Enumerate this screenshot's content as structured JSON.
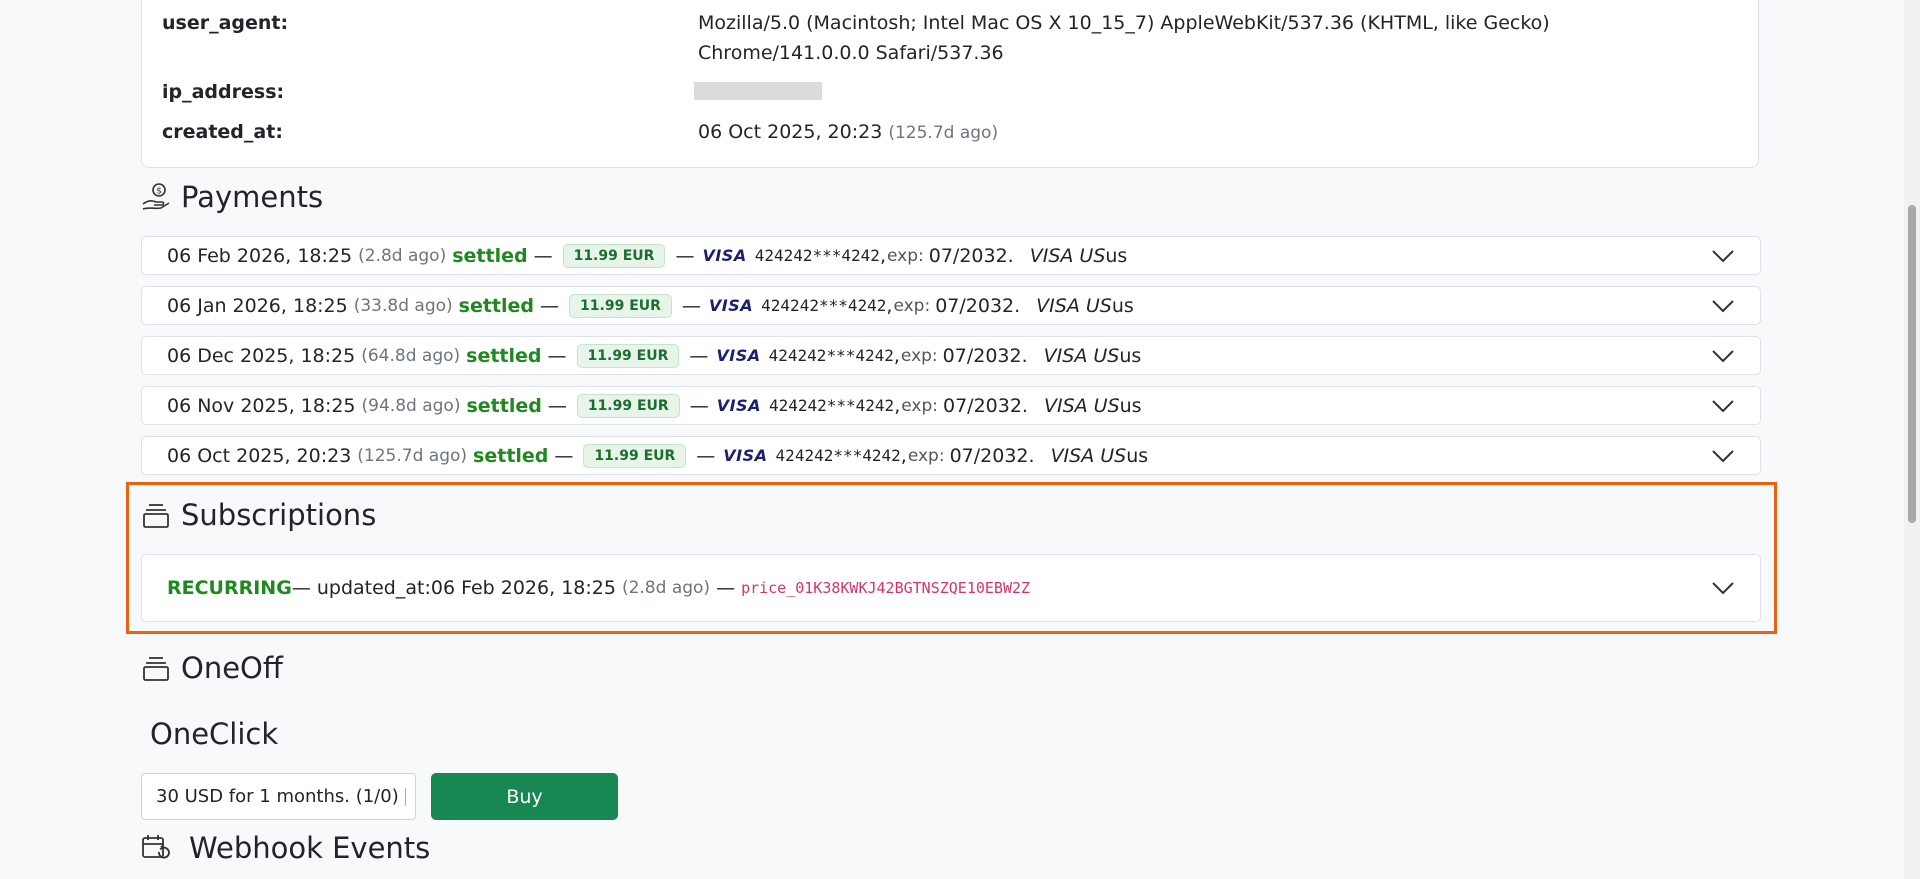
{
  "session": {
    "user_agent_key": "user_agent:",
    "user_agent_val": "Mozilla/5.0 (Macintosh; Intel Mac OS X 10_15_7) AppleWebKit/537.36 (KHTML, like Gecko) Chrome/141.0.0.0 Safari/537.36",
    "ip_key": "ip_address:",
    "created_key": "created_at:",
    "created_val": "06 Oct 2025, 20:23",
    "created_ago": "(125.7d ago)"
  },
  "payments": {
    "title": "Payments",
    "items": [
      {
        "date": "06 Feb 2026, 18:25",
        "ago": "(2.8d ago)",
        "status": "settled",
        "amount": "11.99 EUR",
        "brand": "VISA",
        "card": "424242***4242",
        "exp_label": "exp:",
        "exp": "07/2032.",
        "brand_text": "VISA US",
        "country": "us"
      },
      {
        "date": "06 Jan 2026, 18:25",
        "ago": "(33.8d ago)",
        "status": "settled",
        "amount": "11.99 EUR",
        "brand": "VISA",
        "card": "424242***4242",
        "exp_label": "exp:",
        "exp": "07/2032.",
        "brand_text": "VISA US",
        "country": "us"
      },
      {
        "date": "06 Dec 2025, 18:25",
        "ago": "(64.8d ago)",
        "status": "settled",
        "amount": "11.99 EUR",
        "brand": "VISA",
        "card": "424242***4242",
        "exp_label": "exp:",
        "exp": "07/2032.",
        "brand_text": "VISA US",
        "country": "us"
      },
      {
        "date": "06 Nov 2025, 18:25",
        "ago": "(94.8d ago)",
        "status": "settled",
        "amount": "11.99 EUR",
        "brand": "VISA",
        "card": "424242***4242",
        "exp_label": "exp:",
        "exp": "07/2032.",
        "brand_text": "VISA US",
        "country": "us"
      },
      {
        "date": "06 Oct 2025, 20:23",
        "ago": "(125.7d ago)",
        "status": "settled",
        "amount": "11.99 EUR",
        "brand": "VISA",
        "card": "424242***4242",
        "exp_label": "exp:",
        "exp": "07/2032.",
        "brand_text": "VISA US",
        "country": "us"
      }
    ]
  },
  "subscriptions": {
    "title": "Subscriptions",
    "item": {
      "type": "RECURRING",
      "updated_label": "— updated_at:",
      "updated_val": "06 Feb 2026, 18:25",
      "ago": "(2.8d ago)",
      "sep": "—",
      "price_id": "price_01K38KWKJ42BGTNSZQE10EBW2Z"
    }
  },
  "oneoff": {
    "title": "OneOff"
  },
  "oneclick": {
    "title": "OneClick",
    "select_value": "30 USD for 1 months. (1/0)",
    "buy_label": "Buy"
  },
  "webhooks": {
    "title": "Webhook Events"
  },
  "colors": {
    "settled": "#1e8a1e",
    "buy_button": "#198754",
    "highlight": "#e8620f",
    "price_code": "#d6336c"
  },
  "icons": {
    "payments": "coin-hand-icon",
    "subscriptions": "stack-icon",
    "oneoff": "stack-icon",
    "webhooks": "calendar-refresh-icon",
    "accordion": "chevron-down-icon"
  }
}
